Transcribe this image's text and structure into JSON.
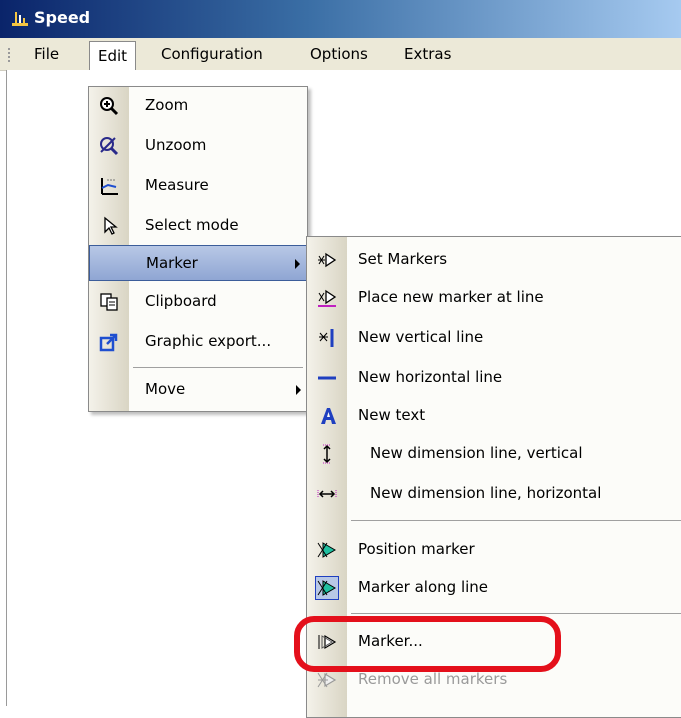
{
  "window": {
    "title": "Speed"
  },
  "menubar": {
    "items": [
      "File",
      "Edit",
      "Configuration",
      "Options",
      "Extras"
    ]
  },
  "edit_menu": {
    "items": [
      {
        "label": "Zoom",
        "icon": "zoom-in-icon"
      },
      {
        "label": "Unzoom",
        "icon": "unzoom-icon"
      },
      {
        "label": "Measure",
        "icon": "measure-icon"
      },
      {
        "label": "Select mode",
        "icon": "cursor-arrow-icon"
      },
      {
        "label": "Marker",
        "icon": "",
        "submenu": true
      },
      {
        "label": "Clipboard",
        "icon": "clipboard-copy-icon"
      },
      {
        "label": "Graphic export...",
        "icon": "export-arrow-icon"
      },
      {
        "label": "Move",
        "icon": "",
        "submenu": true
      }
    ]
  },
  "marker_submenu": {
    "items": [
      {
        "label": "Set Markers",
        "icon": "set-markers-icon"
      },
      {
        "label": "Place new marker at line",
        "icon": "place-marker-icon"
      },
      {
        "label": "New vertical line",
        "icon": "vertical-line-icon"
      },
      {
        "label": "New horizontal line",
        "icon": "horizontal-line-icon"
      },
      {
        "label": "New text",
        "icon": "text-a-icon"
      },
      {
        "label": "New dimension line, vertical",
        "icon": "dimension-vertical-icon"
      },
      {
        "label": "New dimension line, horizontal",
        "icon": "dimension-horizontal-icon"
      },
      {
        "label": "Position marker",
        "icon": "position-marker-icon"
      },
      {
        "label": "Marker along line",
        "icon": "marker-along-line-icon"
      },
      {
        "label": "Marker...",
        "icon": "marker-dialog-icon"
      },
      {
        "label": "Remove all markers",
        "icon": "remove-markers-icon",
        "disabled": true
      }
    ]
  },
  "colors": {
    "highlight_oval": "#e4101b",
    "menu_highlight": "#9fb3d9",
    "titlebar_start": "#0a246a"
  }
}
